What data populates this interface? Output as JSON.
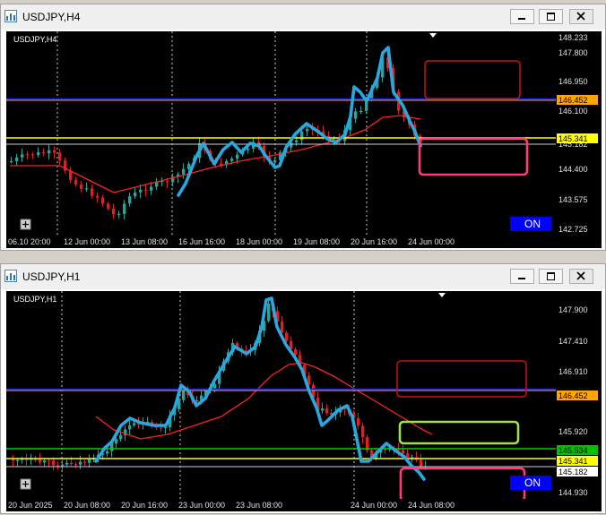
{
  "windows": [
    {
      "title": "USDJPY,H4",
      "symbol_label": "USDJPY,H4",
      "on_label": "ON",
      "price_ticks": [
        "148.233",
        "147.800",
        "146.950",
        "146.100",
        "145.182",
        "144.400",
        "143.575",
        "142.725"
      ],
      "time_ticks": [
        "06.10 20:00",
        "12 Jun 00:00",
        "13 Jun 08:00",
        "16 Jun 16:00",
        "18 Jun 00:00",
        "19 Jun 08:00",
        "20 Jun 16:00",
        "24 Jun 00:00"
      ],
      "markers": [
        {
          "price": "146.452",
          "bg": "#ffa500",
          "fg": "#000000"
        },
        {
          "price": "145.341",
          "bg": "#ffff00",
          "fg": "#000000"
        }
      ]
    },
    {
      "title": "USDJPY,H1",
      "symbol_label": "USDJPY,H1",
      "on_label": "ON",
      "price_ticks": [
        "147.900",
        "147.410",
        "146.910",
        "145.920",
        "144.930"
      ],
      "time_ticks": [
        "20 Jun 2025",
        "20 Jun 08:00",
        "20 Jun 16:00",
        "23 Jun 00:00",
        "23 Jun 08:00",
        "24 Jun 00:00",
        "24 Jun 08:00"
      ],
      "markers": [
        {
          "price": "146.452",
          "bg": "#ffa500",
          "fg": "#000000"
        },
        {
          "price": "145.534",
          "bg": "#00c000",
          "fg": "#000000"
        },
        {
          "price": "145.341",
          "bg": "#ffff00",
          "fg": "#000000"
        },
        {
          "price": "145.182",
          "bg": "#ffffff",
          "fg": "#000000"
        }
      ]
    }
  ],
  "colors": {
    "bull": "#26a69a",
    "bear": "#e02020",
    "ma": "#ff2020",
    "trace": "#29a8e0",
    "blue_line": "#1020ff",
    "orange_line": "#ffa500",
    "yellow_line": "#ffff00",
    "green_line": "#00d000",
    "box_red": "#cc1010",
    "box_pink": "#ff3c78",
    "box_green": "#a0e050",
    "on_bg": "#0000ff"
  }
}
